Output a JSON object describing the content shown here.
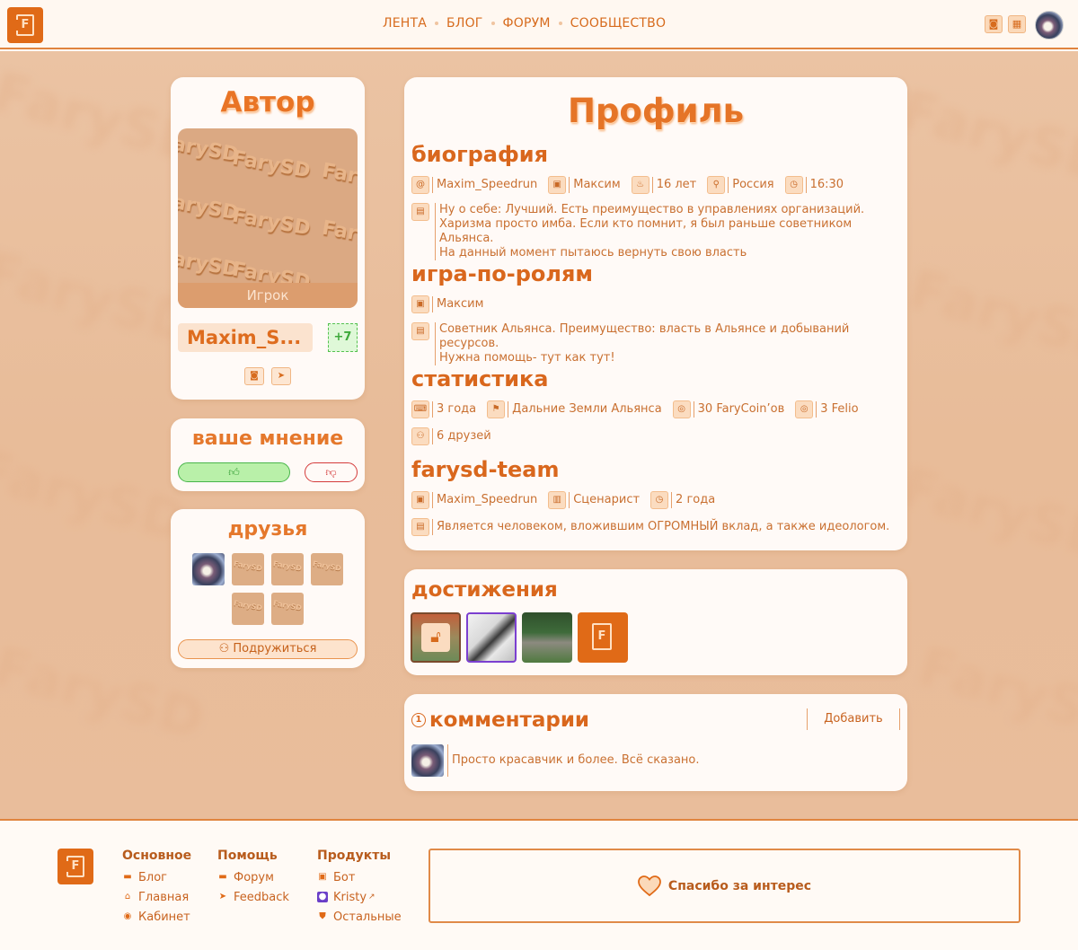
{
  "nav": {
    "items": [
      "ЛЕНТА",
      "БЛОГ",
      "ФОРУМ",
      "СООБЩЕСТВО"
    ]
  },
  "logo_letter": "F",
  "author": {
    "title": "Автор",
    "role": "Игрок",
    "nickname": "Maxim_S...",
    "plus": "+7",
    "watermark": "FarySD"
  },
  "opinion": {
    "title": "ваше мнение"
  },
  "friends": {
    "title": "друзья",
    "befriend_label": "Подружиться"
  },
  "profile": {
    "title": "Профиль",
    "bio": {
      "title": "биография",
      "login": "Maxim_Speedrun",
      "name": "Максим",
      "age": "16 лет",
      "country": "Россия",
      "time": "16:30",
      "about_lines": [
        "Ну о себе: Лучший. Есть преимущество в управлениях организаций.",
        "Харизма просто имба. Если кто помнит, я был раньше советником Альянса.",
        "На данный момент пытаюсь вернуть свою власть"
      ]
    },
    "roleplay": {
      "title": "игра-по-ролям",
      "name": "Максим",
      "about_lines": [
        "Советник Альянса. Преимущество: власть в Альянсе и добываний ресурсов.",
        "Нужна помощь- тут как тут!"
      ]
    },
    "stats": {
      "title": "статистика",
      "played": "3 года",
      "location": "Дальние Земли Альянса",
      "coins": "30 FaryCoin’ов",
      "felio": "3 Felio",
      "friends": "6 друзей"
    },
    "team": {
      "title": "farysd-team",
      "login": "Maxim_Speedrun",
      "position": "Сценарист",
      "duration": "2 года",
      "about": "Является человеком, вложившим ОГРОМНЫЙ вклад, а также идеологом."
    }
  },
  "achievements": {
    "title": "достижения"
  },
  "comments": {
    "count": "1",
    "title": "комментарии",
    "add_label": "Добавить",
    "items": [
      {
        "text": "Просто красавчик и более. Всё сказано."
      }
    ]
  },
  "footer": {
    "col1": {
      "title": "Основное",
      "items": [
        "Блог",
        "Главная",
        "Кабинет"
      ]
    },
    "col2": {
      "title": "Помощь",
      "items": [
        "Форум",
        "Feedback"
      ]
    },
    "col3": {
      "title": "Продукты",
      "items": [
        "Бот",
        "Kristy",
        "Остальные"
      ]
    },
    "thanks": "Спасибо за интерес"
  },
  "colors": {
    "accent": "#e06a17",
    "background": "#ebc3a3",
    "like": "#b9f0a9",
    "dislike": "#d43b3b"
  },
  "icons": {
    "header": [
      "discord-icon",
      "calendar-icon",
      "user-avatar"
    ],
    "bio": [
      "at-icon",
      "id-card-icon",
      "cake-icon",
      "location-pin-icon",
      "clock-icon",
      "message-icon"
    ]
  }
}
